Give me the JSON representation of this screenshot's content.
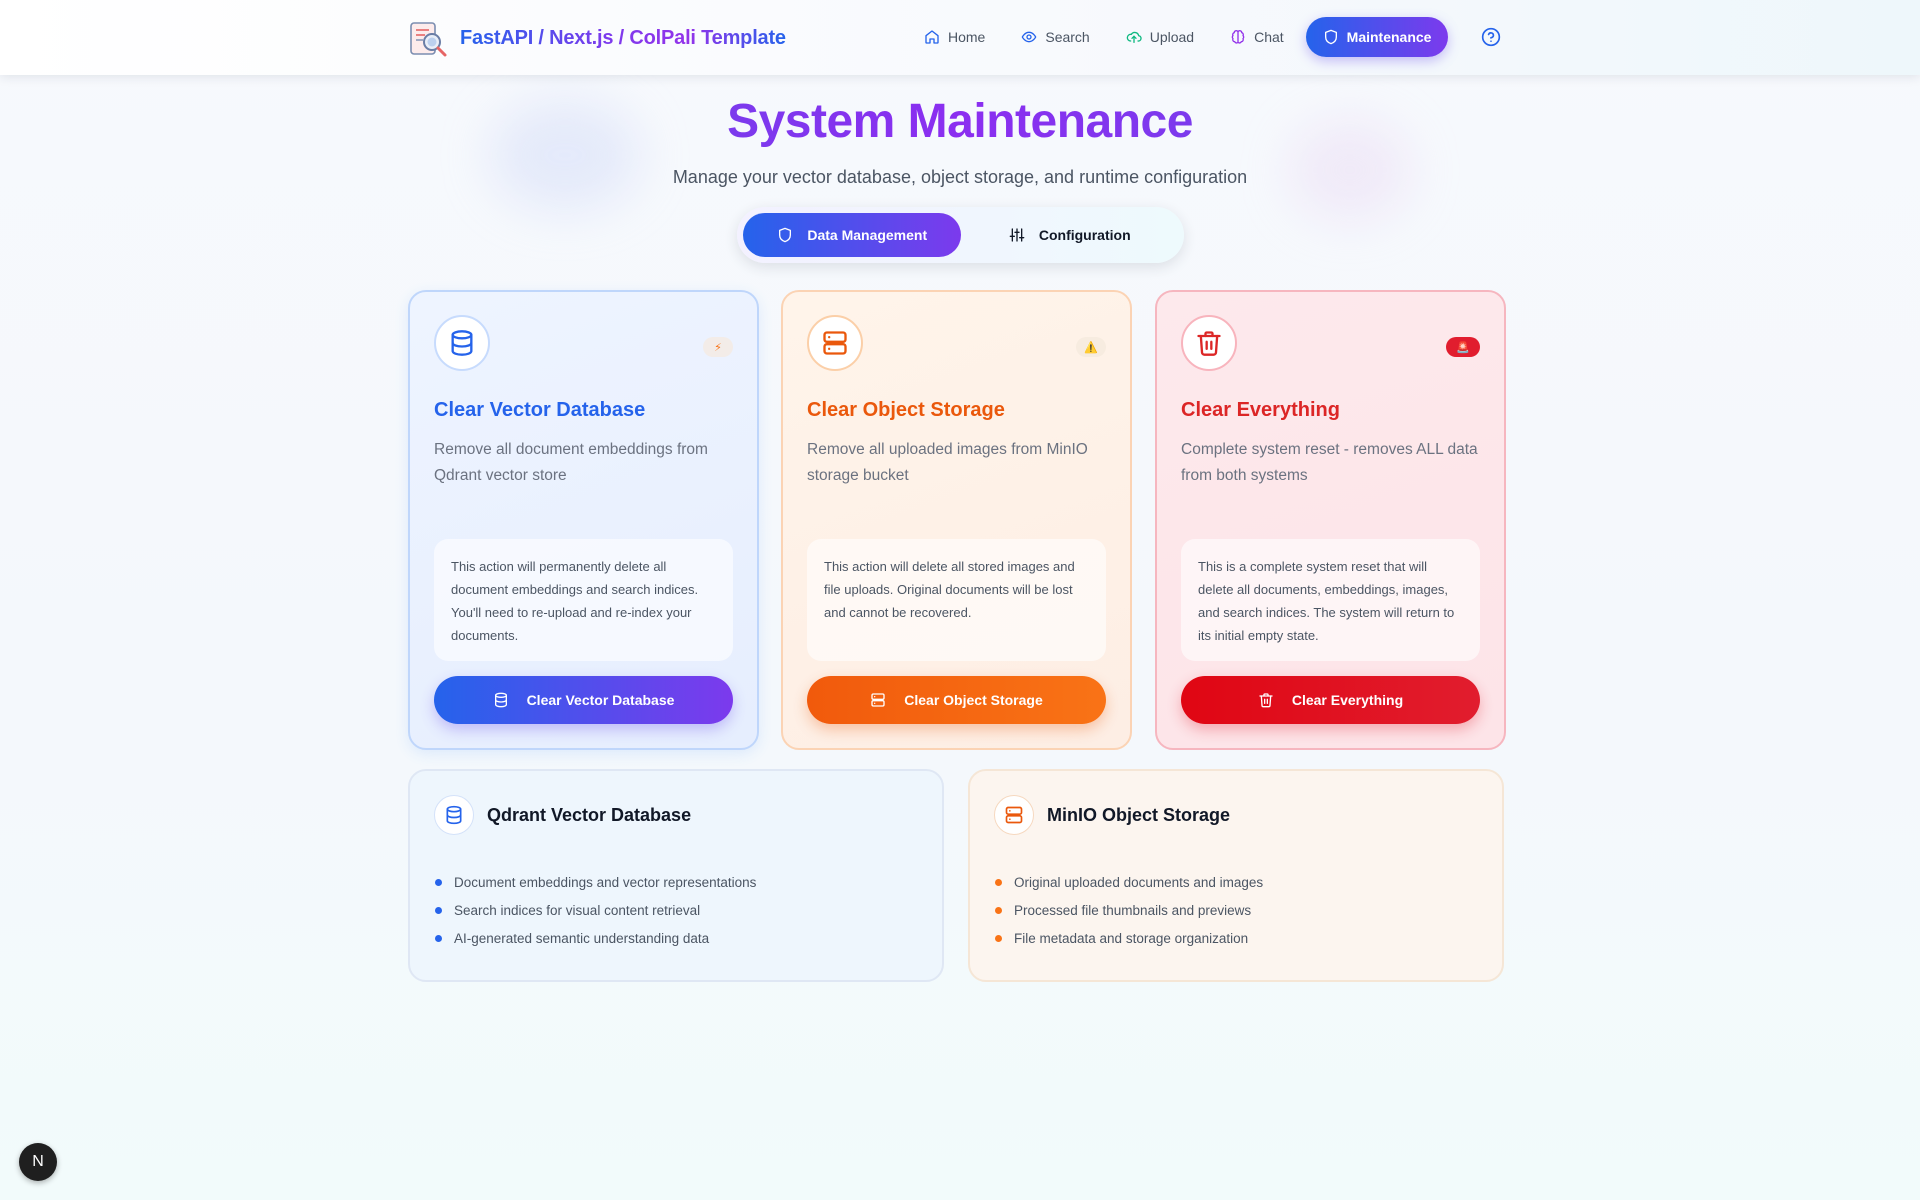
{
  "app": {
    "title": "FastAPI / Next.js / ColPali Template"
  },
  "nav": {
    "items": [
      {
        "label": "Home",
        "icon": "home-icon"
      },
      {
        "label": "Search",
        "icon": "eye-icon"
      },
      {
        "label": "Upload",
        "icon": "cloud-upload-icon"
      },
      {
        "label": "Chat",
        "icon": "brain-icon"
      },
      {
        "label": "Maintenance",
        "icon": "shield-icon",
        "active": true
      }
    ],
    "help_icon": "help-circle-icon"
  },
  "page": {
    "title": "System Maintenance",
    "subtitle": "Manage your vector database, object storage, and runtime configuration"
  },
  "tabs": [
    {
      "label": "Data Management",
      "icon": "shield-icon",
      "active": true
    },
    {
      "label": "Configuration",
      "icon": "sliders-icon",
      "active": false
    }
  ],
  "cards": [
    {
      "title": "Clear Vector Database",
      "description": "Remove all document embeddings from Qdrant vector store",
      "warning": "This action will permanently delete all document embeddings and search indices. You'll need to re-upload and re-index your documents.",
      "button": "Clear Vector Database",
      "badge": "⚡",
      "icon": "database-icon",
      "accent": "#2563eb"
    },
    {
      "title": "Clear Object Storage",
      "description": "Remove all uploaded images from MinIO storage bucket",
      "warning": "This action will delete all stored images and file uploads. Original documents will be lost and cannot be recovered.",
      "button": "Clear Object Storage",
      "badge": "⚠️",
      "icon": "server-icon",
      "accent": "#ea580c"
    },
    {
      "title": "Clear Everything",
      "description": "Complete system reset - removes ALL data from both systems",
      "warning": "This is a complete system reset that will delete all documents, embeddings, images, and search indices. The system will return to its initial empty state.",
      "button": "Clear Everything",
      "badge": "🚨",
      "icon": "trash-icon",
      "accent": "#dc2626"
    }
  ],
  "info_panels": [
    {
      "title": "Qdrant Vector Database",
      "icon": "database-icon",
      "items": [
        "Document embeddings and vector representations",
        "Search indices for visual content retrieval",
        "AI-generated semantic understanding data"
      ]
    },
    {
      "title": "MinIO Object Storage",
      "icon": "server-icon",
      "items": [
        "Original uploaded documents and images",
        "Processed file thumbnails and previews",
        "File metadata and storage organization"
      ]
    }
  ],
  "dev_badge": "N",
  "colors": {
    "primary_gradient_start": "#2563eb",
    "primary_gradient_end": "#7c3aed",
    "orange": "#ea580c",
    "red": "#dc2626"
  }
}
